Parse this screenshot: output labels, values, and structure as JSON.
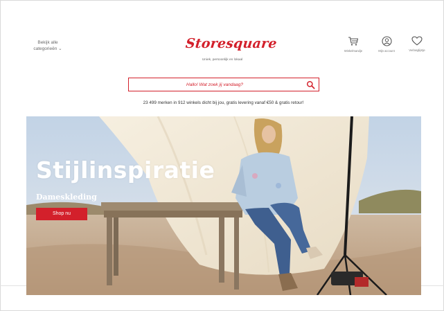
{
  "header": {
    "categories_line1": "Bekijk alle",
    "categories_line2": "categorieën ⌄",
    "logo": "Storesquare",
    "tagline": "Uniek, persoonlijk en lokaal",
    "icons": {
      "cart_label": "Winkelmandje",
      "account_label": "Mijn account",
      "wishlist_label": "Verlanglijstje"
    }
  },
  "search": {
    "placeholder": "Hallo! Wat zoek jij vandaag?"
  },
  "promo_text": "23 499 merken in 912 winkels dicht bij jou, gratis levering vanaf €50 & gratis retour!",
  "hero": {
    "title": "Stijlinspiratie",
    "subtitle": "Dameskleding",
    "button_label": "Shop nu"
  },
  "colors": {
    "brand": "#d3202b",
    "text": "#333333",
    "muted": "#777777"
  }
}
